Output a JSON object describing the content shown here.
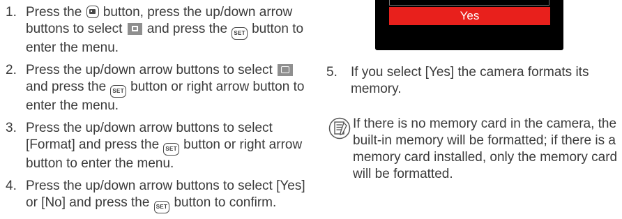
{
  "steps": [
    {
      "num": "1.",
      "parts": [
        "Press the ",
        " button, press the up/down arrow buttons to select ",
        " and press the ",
        " button to enter the menu."
      ]
    },
    {
      "num": "2.",
      "parts": [
        "Press the up/down arrow buttons to select ",
        " and press the ",
        " button or right arrow button to enter the menu."
      ]
    },
    {
      "num": "3.",
      "parts": [
        "Press the up/down arrow buttons to select [Format] and press the ",
        " button or right arrow button to enter the menu."
      ]
    },
    {
      "num": "4.",
      "parts": [
        "Press the up/down arrow buttons to select [Yes] or [No] and press the ",
        " button to confirm."
      ]
    }
  ],
  "set_label": "SET",
  "screen": {
    "selected_option": "Yes",
    "highlight_color": "#e8201c"
  },
  "step5": {
    "num": "5.",
    "text": "If you select [Yes] the camera formats its memory."
  },
  "note": {
    "icon": "note-icon",
    "text": "If there is no memory card in the camera, the built-in memory will be formatted; if there is a memory card installed, only the memory card will be formatted."
  }
}
